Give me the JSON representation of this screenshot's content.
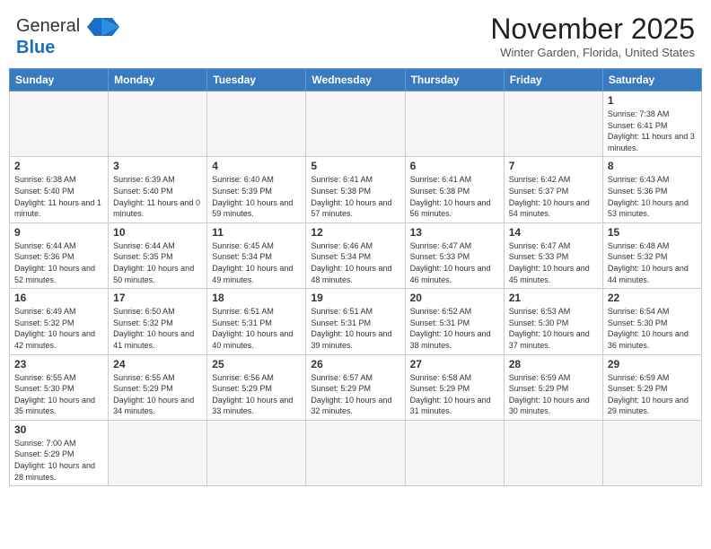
{
  "header": {
    "logo_line1": "General",
    "logo_line2": "Blue",
    "month": "November 2025",
    "location": "Winter Garden, Florida, United States"
  },
  "days_of_week": [
    "Sunday",
    "Monday",
    "Tuesday",
    "Wednesday",
    "Thursday",
    "Friday",
    "Saturday"
  ],
  "weeks": [
    [
      {
        "day": "",
        "info": ""
      },
      {
        "day": "",
        "info": ""
      },
      {
        "day": "",
        "info": ""
      },
      {
        "day": "",
        "info": ""
      },
      {
        "day": "",
        "info": ""
      },
      {
        "day": "",
        "info": ""
      },
      {
        "day": "1",
        "info": "Sunrise: 7:38 AM\nSunset: 6:41 PM\nDaylight: 11 hours\nand 3 minutes."
      }
    ],
    [
      {
        "day": "2",
        "info": "Sunrise: 6:38 AM\nSunset: 5:40 PM\nDaylight: 11 hours\nand 1 minute."
      },
      {
        "day": "3",
        "info": "Sunrise: 6:39 AM\nSunset: 5:40 PM\nDaylight: 11 hours\nand 0 minutes."
      },
      {
        "day": "4",
        "info": "Sunrise: 6:40 AM\nSunset: 5:39 PM\nDaylight: 10 hours\nand 59 minutes."
      },
      {
        "day": "5",
        "info": "Sunrise: 6:41 AM\nSunset: 5:38 PM\nDaylight: 10 hours\nand 57 minutes."
      },
      {
        "day": "6",
        "info": "Sunrise: 6:41 AM\nSunset: 5:38 PM\nDaylight: 10 hours\nand 56 minutes."
      },
      {
        "day": "7",
        "info": "Sunrise: 6:42 AM\nSunset: 5:37 PM\nDaylight: 10 hours\nand 54 minutes."
      },
      {
        "day": "8",
        "info": "Sunrise: 6:43 AM\nSunset: 5:36 PM\nDaylight: 10 hours\nand 53 minutes."
      }
    ],
    [
      {
        "day": "9",
        "info": "Sunrise: 6:44 AM\nSunset: 5:36 PM\nDaylight: 10 hours\nand 52 minutes."
      },
      {
        "day": "10",
        "info": "Sunrise: 6:44 AM\nSunset: 5:35 PM\nDaylight: 10 hours\nand 50 minutes."
      },
      {
        "day": "11",
        "info": "Sunrise: 6:45 AM\nSunset: 5:34 PM\nDaylight: 10 hours\nand 49 minutes."
      },
      {
        "day": "12",
        "info": "Sunrise: 6:46 AM\nSunset: 5:34 PM\nDaylight: 10 hours\nand 48 minutes."
      },
      {
        "day": "13",
        "info": "Sunrise: 6:47 AM\nSunset: 5:33 PM\nDaylight: 10 hours\nand 46 minutes."
      },
      {
        "day": "14",
        "info": "Sunrise: 6:47 AM\nSunset: 5:33 PM\nDaylight: 10 hours\nand 45 minutes."
      },
      {
        "day": "15",
        "info": "Sunrise: 6:48 AM\nSunset: 5:32 PM\nDaylight: 10 hours\nand 44 minutes."
      }
    ],
    [
      {
        "day": "16",
        "info": "Sunrise: 6:49 AM\nSunset: 5:32 PM\nDaylight: 10 hours\nand 42 minutes."
      },
      {
        "day": "17",
        "info": "Sunrise: 6:50 AM\nSunset: 5:32 PM\nDaylight: 10 hours\nand 41 minutes."
      },
      {
        "day": "18",
        "info": "Sunrise: 6:51 AM\nSunset: 5:31 PM\nDaylight: 10 hours\nand 40 minutes."
      },
      {
        "day": "19",
        "info": "Sunrise: 6:51 AM\nSunset: 5:31 PM\nDaylight: 10 hours\nand 39 minutes."
      },
      {
        "day": "20",
        "info": "Sunrise: 6:52 AM\nSunset: 5:31 PM\nDaylight: 10 hours\nand 38 minutes."
      },
      {
        "day": "21",
        "info": "Sunrise: 6:53 AM\nSunset: 5:30 PM\nDaylight: 10 hours\nand 37 minutes."
      },
      {
        "day": "22",
        "info": "Sunrise: 6:54 AM\nSunset: 5:30 PM\nDaylight: 10 hours\nand 36 minutes."
      }
    ],
    [
      {
        "day": "23",
        "info": "Sunrise: 6:55 AM\nSunset: 5:30 PM\nDaylight: 10 hours\nand 35 minutes."
      },
      {
        "day": "24",
        "info": "Sunrise: 6:55 AM\nSunset: 5:29 PM\nDaylight: 10 hours\nand 34 minutes."
      },
      {
        "day": "25",
        "info": "Sunrise: 6:56 AM\nSunset: 5:29 PM\nDaylight: 10 hours\nand 33 minutes."
      },
      {
        "day": "26",
        "info": "Sunrise: 6:57 AM\nSunset: 5:29 PM\nDaylight: 10 hours\nand 32 minutes."
      },
      {
        "day": "27",
        "info": "Sunrise: 6:58 AM\nSunset: 5:29 PM\nDaylight: 10 hours\nand 31 minutes."
      },
      {
        "day": "28",
        "info": "Sunrise: 6:59 AM\nSunset: 5:29 PM\nDaylight: 10 hours\nand 30 minutes."
      },
      {
        "day": "29",
        "info": "Sunrise: 6:59 AM\nSunset: 5:29 PM\nDaylight: 10 hours\nand 29 minutes."
      }
    ],
    [
      {
        "day": "30",
        "info": "Sunrise: 7:00 AM\nSunset: 5:29 PM\nDaylight: 10 hours\nand 28 minutes."
      },
      {
        "day": "",
        "info": ""
      },
      {
        "day": "",
        "info": ""
      },
      {
        "day": "",
        "info": ""
      },
      {
        "day": "",
        "info": ""
      },
      {
        "day": "",
        "info": ""
      },
      {
        "day": "",
        "info": ""
      }
    ]
  ]
}
